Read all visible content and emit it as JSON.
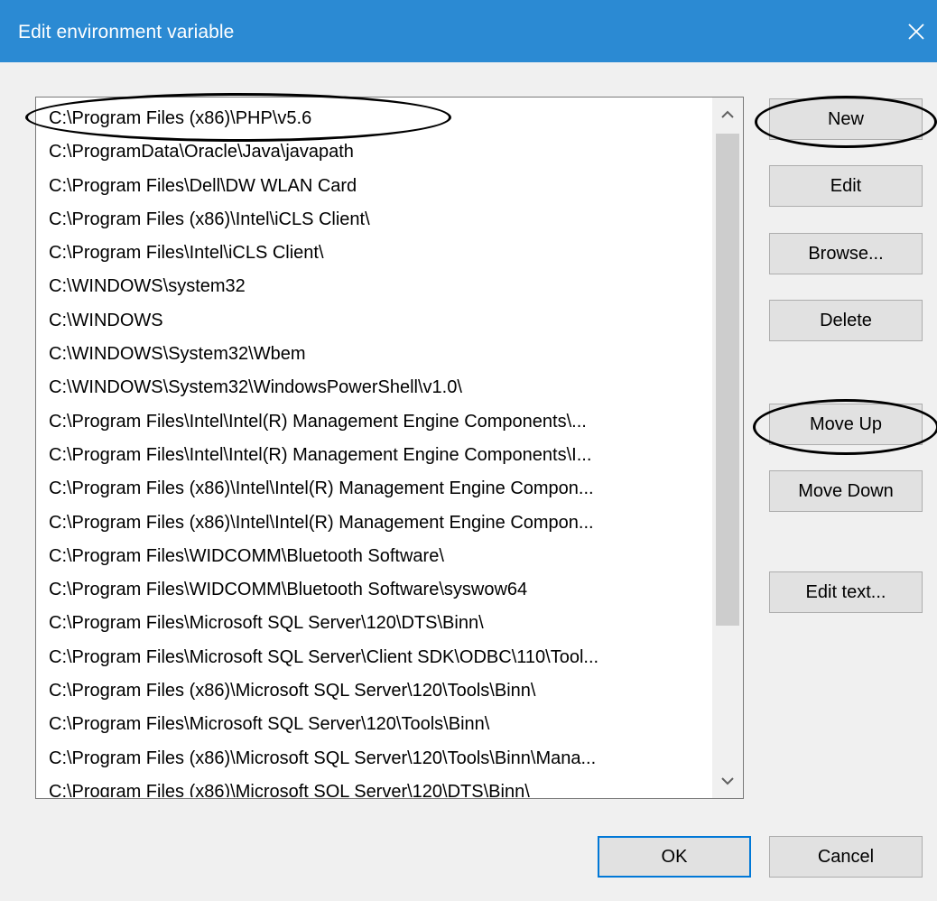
{
  "window": {
    "title": "Edit environment variable",
    "close_icon": "close-icon"
  },
  "path_list": {
    "items": [
      "C:\\Program Files (x86)\\PHP\\v5.6",
      "C:\\ProgramData\\Oracle\\Java\\javapath",
      "C:\\Program Files\\Dell\\DW WLAN Card",
      "C:\\Program Files (x86)\\Intel\\iCLS Client\\",
      "C:\\Program Files\\Intel\\iCLS Client\\",
      "C:\\WINDOWS\\system32",
      "C:\\WINDOWS",
      "C:\\WINDOWS\\System32\\Wbem",
      "C:\\WINDOWS\\System32\\WindowsPowerShell\\v1.0\\",
      "C:\\Program Files\\Intel\\Intel(R) Management Engine Components\\...",
      "C:\\Program Files\\Intel\\Intel(R) Management Engine Components\\I...",
      "C:\\Program Files (x86)\\Intel\\Intel(R) Management Engine Compon...",
      "C:\\Program Files (x86)\\Intel\\Intel(R) Management Engine Compon...",
      "C:\\Program Files\\WIDCOMM\\Bluetooth Software\\",
      "C:\\Program Files\\WIDCOMM\\Bluetooth Software\\syswow64",
      "C:\\Program Files\\Microsoft SQL Server\\120\\DTS\\Binn\\",
      "C:\\Program Files\\Microsoft SQL Server\\Client SDK\\ODBC\\110\\Tool...",
      "C:\\Program Files (x86)\\Microsoft SQL Server\\120\\Tools\\Binn\\",
      "C:\\Program Files\\Microsoft SQL Server\\120\\Tools\\Binn\\",
      "C:\\Program Files (x86)\\Microsoft SQL Server\\120\\Tools\\Binn\\Mana...",
      "C:\\Program Files (x86)\\Microsoft SQL Server\\120\\DTS\\Binn\\"
    ]
  },
  "buttons": {
    "new": "New",
    "edit": "Edit",
    "browse": "Browse...",
    "delete": "Delete",
    "move_up": "Move Up",
    "move_down": "Move Down",
    "edit_text": "Edit text...",
    "ok": "OK",
    "cancel": "Cancel"
  },
  "colors": {
    "titlebar": "#2b8ad3",
    "dialog_bg": "#f0f0f0",
    "default_button_border": "#0078d7",
    "annotation": "#000000"
  }
}
